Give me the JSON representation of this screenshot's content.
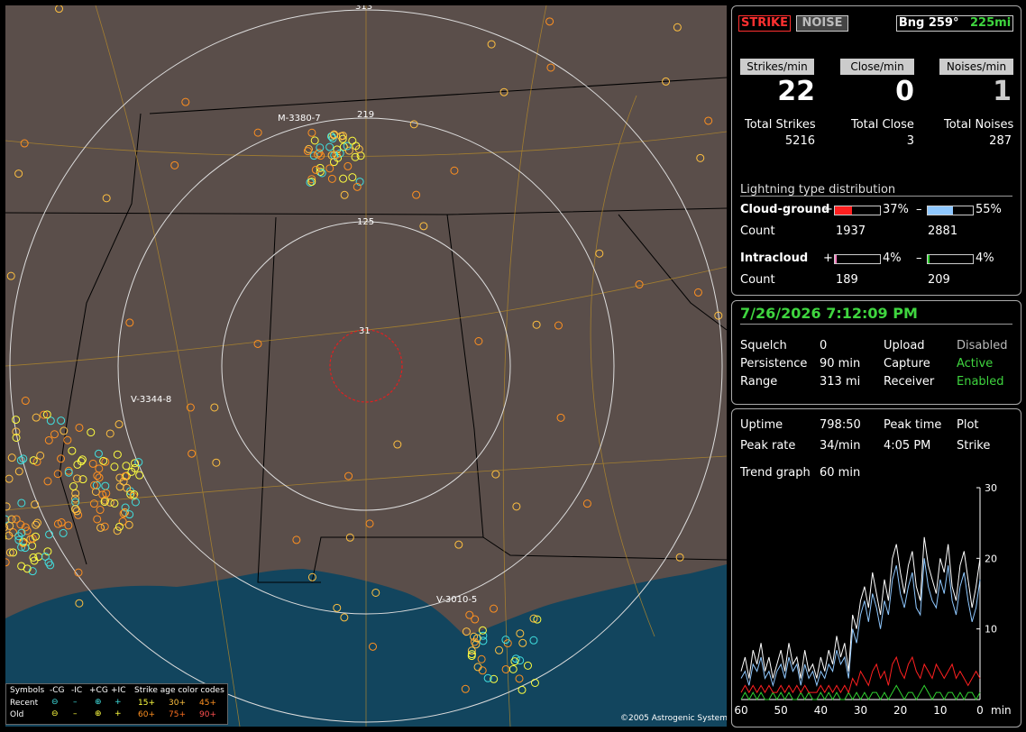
{
  "map": {
    "range_labels": [
      "313",
      "219",
      "125",
      "31"
    ],
    "station_labels": [
      "M-3380-7",
      "V-3344-8",
      "V-3010-5"
    ],
    "copyright": "©2005 Astrogenic Systems"
  },
  "legend": {
    "title": "Symbols",
    "col_headers": [
      "-CG",
      "-IC",
      "+CG",
      "+IC"
    ],
    "rows": [
      {
        "label": "Recent",
        "symbols": [
          "⊖",
          "–",
          "⊕",
          "+"
        ]
      },
      {
        "label": "Old",
        "symbols": [
          "⊖",
          "–",
          "⊕",
          "+"
        ]
      }
    ],
    "age_title": "Strike age color codes",
    "ages_recent": [
      "15+",
      "30+",
      "45+"
    ],
    "ages_old": [
      "60+",
      "75+",
      "90+"
    ]
  },
  "header": {
    "strike_button": "STRIKE",
    "noise_button": "NOISE",
    "bearing": "Bng 259°",
    "distance": "225mi"
  },
  "stats": {
    "strikes_min_label": "Strikes/min",
    "close_min_label": "Close/min",
    "noises_min_label": "Noises/min",
    "strikes_min": "22",
    "close_min": "0",
    "noises_min": "1",
    "total_strikes_label": "Total Strikes",
    "total_close_label": "Total Close",
    "total_noises_label": "Total Noises",
    "total_strikes": "5216",
    "total_close": "3",
    "total_noises": "287"
  },
  "distribution": {
    "title": "Lightning type distribution",
    "cg_label": "Cloud-ground",
    "ic_label": "Intracloud",
    "count_label": "Count",
    "plus": "+",
    "minus": "–",
    "cg_plus_pct": "37%",
    "cg_minus_pct": "55%",
    "ic_plus_pct": "4%",
    "ic_minus_pct": "4%",
    "cg_plus_count": "1937",
    "cg_minus_count": "2881",
    "ic_plus_count": "189",
    "ic_minus_count": "209",
    "cg_plus_frac": 0.37,
    "cg_minus_frac": 0.55,
    "ic_plus_frac": 0.04,
    "ic_minus_frac": 0.04
  },
  "status": {
    "datetime": "7/26/2026 7:12:09 PM",
    "squelch_label": "Squelch",
    "squelch": "0",
    "persistence_label": "Persistence",
    "persistence": "90 min",
    "range_label": "Range",
    "range": "313 mi",
    "upload_label": "Upload",
    "upload": "Disabled",
    "capture_label": "Capture",
    "capture": "Active",
    "receiver_label": "Receiver",
    "receiver": "Enabled"
  },
  "trend": {
    "uptime_label": "Uptime",
    "uptime": "798:50",
    "peak_time_label": "Peak time",
    "peak_time": "4:05 PM",
    "plot_label": "Plot",
    "plot": "Strike",
    "peak_rate_label": "Peak rate",
    "peak_rate": "34/min",
    "trend_graph_label": "Trend graph",
    "trend_graph": "60 min",
    "y_ticks": [
      "30",
      "20",
      "10",
      "0"
    ],
    "x_ticks": [
      "60",
      "50",
      "40",
      "30",
      "20",
      "10",
      "0"
    ],
    "x_unit": "min"
  },
  "colors": {
    "strike_red": "#ff3030",
    "cg_plus": "#ff2020",
    "cg_minus": "#8fc8ff",
    "ic_plus": "#ff80c0",
    "ic_minus": "#30d030",
    "recent": "#ffff40",
    "old": "#ff9020",
    "cyan": "#40e0e0"
  },
  "chart_data": {
    "type": "line",
    "x": [
      60,
      59,
      58,
      57,
      56,
      55,
      54,
      53,
      52,
      51,
      50,
      49,
      48,
      47,
      46,
      45,
      44,
      43,
      42,
      41,
      40,
      39,
      38,
      37,
      36,
      35,
      34,
      33,
      32,
      31,
      30,
      29,
      28,
      27,
      26,
      25,
      24,
      23,
      22,
      21,
      20,
      19,
      18,
      17,
      16,
      15,
      14,
      13,
      12,
      11,
      10,
      9,
      8,
      7,
      6,
      5,
      4,
      3,
      2,
      1,
      0
    ],
    "ylim": [
      0,
      30
    ],
    "series": [
      {
        "name": "total",
        "color": "#ffffff",
        "values": [
          4,
          6,
          3,
          7,
          5,
          8,
          4,
          6,
          3,
          5,
          7,
          4,
          8,
          5,
          6,
          3,
          7,
          4,
          5,
          3,
          6,
          4,
          7,
          5,
          9,
          6,
          8,
          4,
          12,
          10,
          14,
          16,
          13,
          18,
          15,
          12,
          17,
          14,
          20,
          22,
          18,
          15,
          19,
          21,
          16,
          14,
          23,
          19,
          17,
          15,
          20,
          18,
          22,
          16,
          14,
          19,
          21,
          17,
          13,
          16,
          20
        ]
      },
      {
        "name": "cg-",
        "color": "#8fc8ff",
        "values": [
          3,
          4,
          2,
          5,
          4,
          6,
          3,
          4,
          2,
          4,
          5,
          3,
          6,
          4,
          5,
          2,
          5,
          3,
          4,
          2,
          4,
          3,
          5,
          4,
          7,
          5,
          6,
          3,
          10,
          8,
          12,
          14,
          11,
          15,
          13,
          10,
          14,
          12,
          17,
          19,
          15,
          13,
          16,
          18,
          13,
          12,
          20,
          16,
          14,
          13,
          17,
          15,
          19,
          14,
          12,
          16,
          18,
          14,
          11,
          13,
          17
        ]
      },
      {
        "name": "cg+",
        "color": "#ff2020",
        "values": [
          1,
          2,
          1,
          2,
          1,
          2,
          1,
          2,
          1,
          1,
          2,
          1,
          2,
          1,
          2,
          1,
          2,
          1,
          1,
          1,
          2,
          1,
          2,
          1,
          2,
          1,
          2,
          1,
          3,
          2,
          4,
          3,
          2,
          4,
          5,
          3,
          4,
          2,
          5,
          6,
          4,
          3,
          5,
          6,
          4,
          3,
          5,
          4,
          3,
          5,
          4,
          3,
          4,
          5,
          3,
          4,
          3,
          2,
          3,
          4,
          3
        ]
      },
      {
        "name": "ic",
        "color": "#30d030",
        "values": [
          0,
          1,
          0,
          1,
          0,
          1,
          0,
          0,
          1,
          0,
          1,
          0,
          1,
          0,
          0,
          1,
          0,
          1,
          0,
          0,
          1,
          0,
          1,
          0,
          1,
          0,
          0,
          1,
          0,
          1,
          0,
          1,
          0,
          1,
          1,
          0,
          1,
          0,
          1,
          2,
          1,
          0,
          1,
          1,
          0,
          1,
          2,
          1,
          0,
          1,
          1,
          0,
          1,
          1,
          0,
          1,
          0,
          1,
          1,
          0,
          1
        ]
      }
    ]
  }
}
